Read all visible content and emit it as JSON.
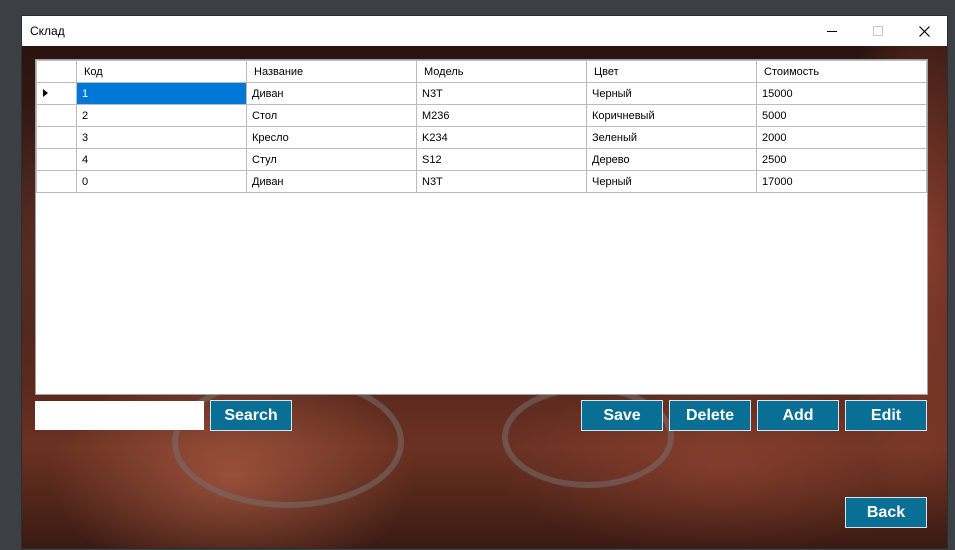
{
  "window": {
    "title": "Склад"
  },
  "grid": {
    "columns": [
      "Код",
      "Название",
      "Модель",
      "Цвет",
      "Стоимость"
    ],
    "rows": [
      [
        "1",
        "Диван",
        "N3T",
        "Черный",
        "15000"
      ],
      [
        "2",
        "Стол",
        "M236",
        "Коричневый",
        "5000"
      ],
      [
        "3",
        "Кресло",
        "K234",
        "Зеленый",
        "2000"
      ],
      [
        "4",
        "Стул",
        "S12",
        "Дерево",
        "2500"
      ],
      [
        "0",
        "Диван",
        "N3T",
        "Черный",
        "17000"
      ]
    ],
    "selected_row": 0
  },
  "search": {
    "value": "",
    "button_label": "Search"
  },
  "actions": {
    "save_label": "Save",
    "delete_label": "Delete",
    "add_label": "Add",
    "edit_label": "Edit",
    "back_label": "Back"
  },
  "colors": {
    "button": "#0a6f95",
    "selection": "#0078d7"
  },
  "icons": [
    "minimize-icon",
    "maximize-icon",
    "close-icon",
    "row-pointer-icon"
  ]
}
